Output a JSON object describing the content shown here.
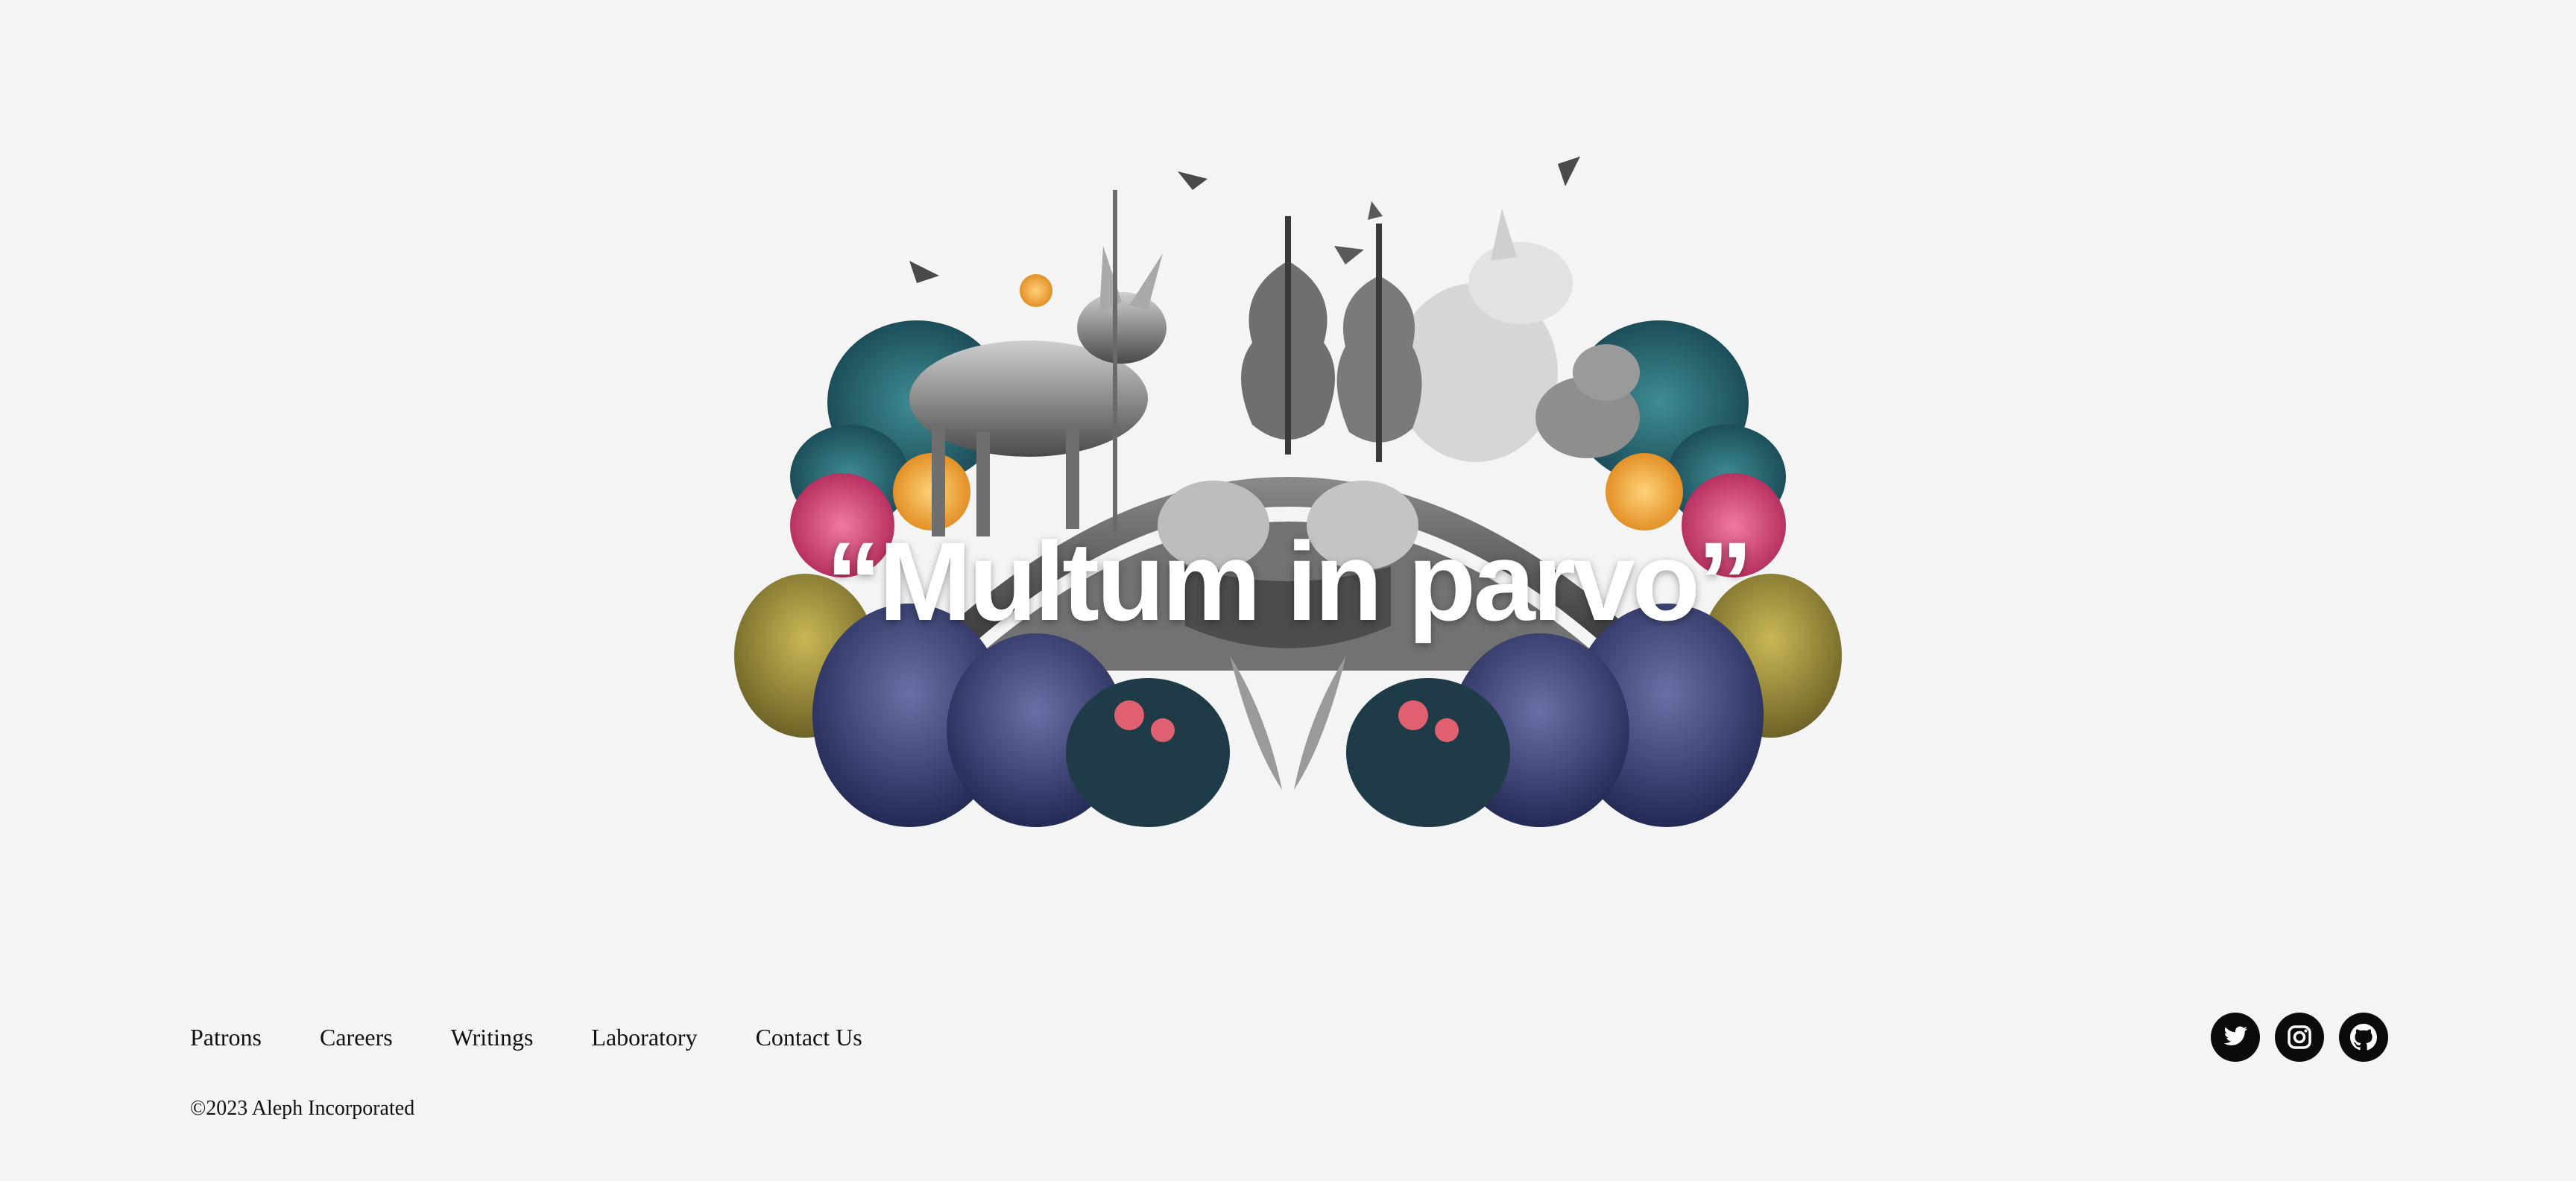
{
  "hero": {
    "motto": "“Multum in parvo”",
    "artwork": "symmetric collage of animals, cellos, birds and tropical flowers"
  },
  "footer": {
    "nav": [
      {
        "label": "Patrons"
      },
      {
        "label": "Careers"
      },
      {
        "label": "Writings"
      },
      {
        "label": "Laboratory"
      },
      {
        "label": "Contact Us"
      }
    ],
    "copyright": "©2023 Aleph Incorporated",
    "social": [
      {
        "icon": "twitter-icon"
      },
      {
        "icon": "instagram-icon"
      },
      {
        "icon": "github-icon"
      }
    ]
  },
  "colors": {
    "background": "#f4f4f4",
    "text": "#111111",
    "icon_fill": "#0b0b0b",
    "motto": "#ffffff"
  }
}
